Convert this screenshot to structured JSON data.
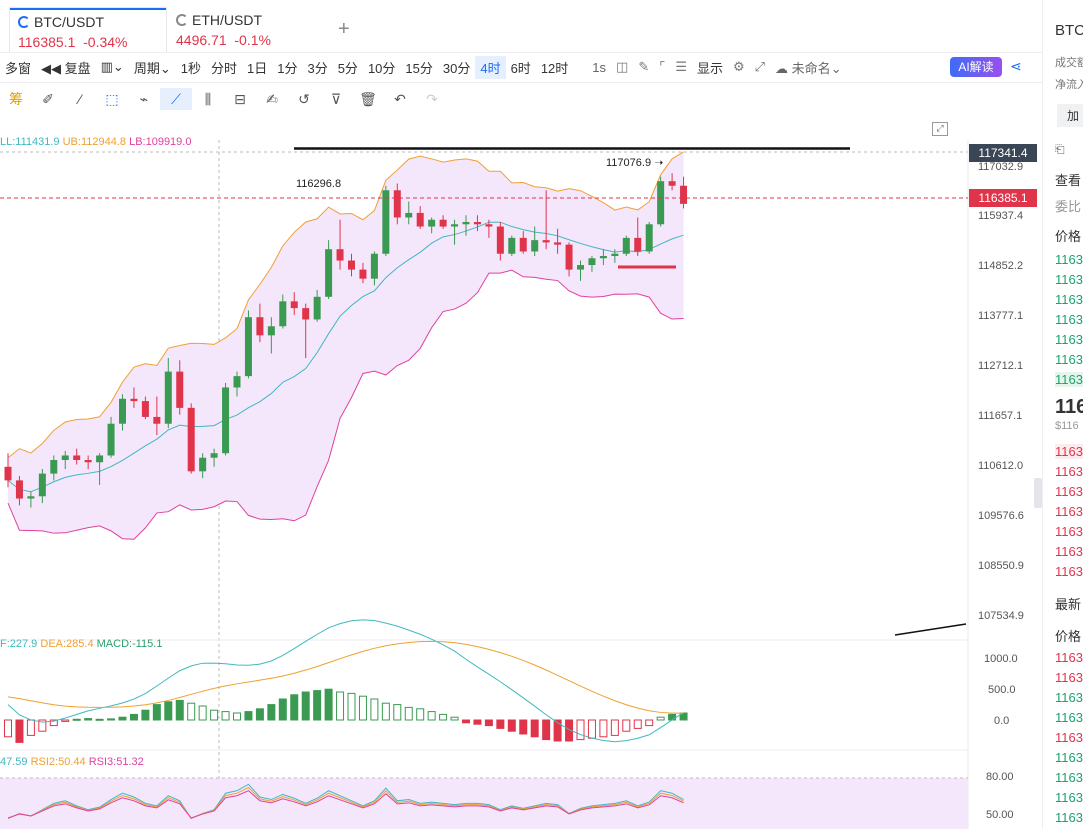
{
  "tabs": [
    {
      "symbol": "BTC/USDT",
      "price": "116385.1",
      "change": "-0.34%"
    },
    {
      "symbol": "ETH/USDT",
      "price": "4496.71",
      "change": "-0.1%"
    }
  ],
  "add_tab_label": "+",
  "toolbar": {
    "items": [
      "多窗",
      "复盘",
      "周期",
      "1秒",
      "分时",
      "1日",
      "1分",
      "3分",
      "5分",
      "10分",
      "15分",
      "30分",
      "4时",
      "6时",
      "12时",
      "1s"
    ],
    "selected": "4时",
    "display_label": "显示",
    "layout_name": "未命名",
    "ai_label": "AI解读"
  },
  "drawing_tools_label": "筹",
  "chart": {
    "boll_label": {
      "mid": "LL:111431.9",
      "ub": "UB:112944.8",
      "lb": "LB:109919.0"
    },
    "macd_label": {
      "dif": "F:227.9",
      "dea": "DEA:285.4",
      "macd": "MACD:-115.1"
    },
    "rsi_label": {
      "rsi1": "47.59",
      "rsi2": "RSI2:50.44",
      "rsi3": "RSI3:51.32"
    },
    "annotations": {
      "high": "117076.9",
      "line_label": "116296.8"
    },
    "price_axis": [
      "117032.9",
      "115937.4",
      "114852.2",
      "113777.1",
      "112712.1",
      "111657.1",
      "110612.0",
      "109576.6",
      "108550.9",
      "107534.9"
    ],
    "macd_axis": [
      "1000.0",
      "500.0",
      "0.0"
    ],
    "rsi_axis": [
      "80.00",
      "50.00"
    ],
    "tag_top": "117341.4",
    "tag_current": "116385.1",
    "colors": {
      "up": "#3a9a52",
      "down": "#e0344b",
      "band_fill": "#f4e6fb",
      "ub": "#f0a030",
      "lb": "#e040a0",
      "mid": "#40b8c0"
    }
  },
  "chart_data": {
    "type": "candlestick",
    "timeframe": "4时",
    "ohlc": [
      [
        110600,
        110900,
        110150,
        110300
      ],
      [
        110300,
        110400,
        109750,
        109900
      ],
      [
        109900,
        110050,
        109700,
        109950
      ],
      [
        109950,
        110550,
        109800,
        110450
      ],
      [
        110450,
        110850,
        110300,
        110750
      ],
      [
        110750,
        110950,
        110550,
        110850
      ],
      [
        110850,
        111000,
        110650,
        110750
      ],
      [
        110750,
        110850,
        110550,
        110700
      ],
      [
        110700,
        110900,
        110200,
        110850
      ],
      [
        110850,
        111700,
        110800,
        111550
      ],
      [
        111550,
        112200,
        111400,
        112100
      ],
      [
        112100,
        112350,
        111900,
        112050
      ],
      [
        112050,
        112150,
        111650,
        111700
      ],
      [
        111700,
        112150,
        111300,
        111550
      ],
      [
        111550,
        113000,
        111450,
        112700
      ],
      [
        112700,
        112950,
        111750,
        111900
      ],
      [
        111900,
        112000,
        110450,
        110500
      ],
      [
        110500,
        110900,
        110350,
        110800
      ],
      [
        110800,
        111000,
        110600,
        110900
      ],
      [
        110900,
        112450,
        110850,
        112350
      ],
      [
        112350,
        112700,
        112150,
        112600
      ],
      [
        112600,
        114050,
        112550,
        113900
      ],
      [
        113900,
        114200,
        113350,
        113500
      ],
      [
        113500,
        113900,
        113100,
        113700
      ],
      [
        113700,
        114400,
        113650,
        114250
      ],
      [
        114250,
        114450,
        113950,
        114100
      ],
      [
        114100,
        114200,
        113000,
        113850
      ],
      [
        113850,
        114500,
        113800,
        114350
      ],
      [
        114350,
        115600,
        114300,
        115400
      ],
      [
        115400,
        116050,
        114950,
        115150
      ],
      [
        115150,
        115300,
        114800,
        114950
      ],
      [
        114950,
        115100,
        114650,
        114750
      ],
      [
        114750,
        115350,
        114600,
        115300
      ],
      [
        115300,
        116800,
        115250,
        116700
      ],
      [
        116700,
        116850,
        115950,
        116100
      ],
      [
        116100,
        116450,
        115950,
        116200
      ],
      [
        116200,
        116350,
        115850,
        115900
      ],
      [
        115900,
        116100,
        115750,
        116050
      ],
      [
        116050,
        116150,
        115850,
        115900
      ],
      [
        115900,
        116050,
        115500,
        115950
      ],
      [
        115950,
        116150,
        115700,
        116000
      ],
      [
        116000,
        116150,
        115800,
        115950
      ],
      [
        115950,
        116050,
        115650,
        115900
      ],
      [
        115900,
        116000,
        115150,
        115300
      ],
      [
        115300,
        115700,
        115250,
        115650
      ],
      [
        115650,
        115800,
        115300,
        115350
      ],
      [
        115350,
        115900,
        115250,
        115600
      ],
      [
        115600,
        116700,
        115400,
        115550
      ],
      [
        115550,
        115850,
        115300,
        115500
      ],
      [
        115500,
        115550,
        114800,
        114950
      ],
      [
        114950,
        115150,
        114700,
        115050
      ],
      [
        115050,
        115250,
        114900,
        115200
      ],
      [
        115200,
        115400,
        115050,
        115250
      ],
      [
        115250,
        115400,
        115100,
        115300
      ],
      [
        115300,
        115700,
        115250,
        115650
      ],
      [
        115650,
        116100,
        115250,
        115350
      ],
      [
        115350,
        116000,
        115300,
        115950
      ],
      [
        115950,
        117000,
        115900,
        116900
      ],
      [
        116900,
        117076.9,
        116700,
        116800
      ],
      [
        116800,
        117000,
        116300,
        116400
      ]
    ],
    "ylim": [
      107000,
      117500
    ],
    "macd_hist": [
      -120,
      -160,
      -110,
      -80,
      -40,
      -10,
      5,
      10,
      5,
      8,
      20,
      40,
      70,
      110,
      130,
      140,
      120,
      100,
      70,
      60,
      50,
      60,
      80,
      110,
      150,
      180,
      200,
      210,
      220,
      200,
      190,
      170,
      150,
      120,
      110,
      90,
      80,
      60,
      40,
      20,
      -20,
      -30,
      -40,
      -60,
      -80,
      -100,
      -120,
      -140,
      -150,
      -150,
      -140,
      -130,
      -120,
      -110,
      -80,
      -60,
      -40,
      20,
      40,
      50
    ],
    "rsi": [
      48,
      52,
      50,
      55,
      60,
      62,
      58,
      55,
      57,
      63,
      68,
      65,
      60,
      58,
      66,
      62,
      48,
      52,
      55,
      68,
      70,
      75,
      65,
      63,
      67,
      64,
      60,
      64,
      70,
      66,
      62,
      58,
      62,
      72,
      62,
      63,
      60,
      61,
      60,
      59,
      60,
      60,
      59,
      55,
      58,
      56,
      58,
      60,
      59,
      52,
      56,
      58,
      59,
      60,
      62,
      58,
      61,
      70,
      68,
      63
    ]
  },
  "right_panel": {
    "title": "BTC",
    "line1": "成交额",
    "line2": "净流入",
    "add_btn": "加",
    "section1": "查看",
    "section2": "委比",
    "price_header": "价格",
    "asks": [
      "1163",
      "1163",
      "1163",
      "1163",
      "1163",
      "1163",
      "1163"
    ],
    "last_price": "116",
    "last_sub": "$116",
    "bids": [
      "1163",
      "1163",
      "1163",
      "1163",
      "1163",
      "1163",
      "1163"
    ],
    "latest_trades_title": "最新",
    "trades_header": "价格",
    "trades": [
      "1163",
      "1163",
      "1163",
      "1163",
      "1163",
      "1163",
      "1163",
      "1163",
      "1163",
      "1163"
    ]
  }
}
